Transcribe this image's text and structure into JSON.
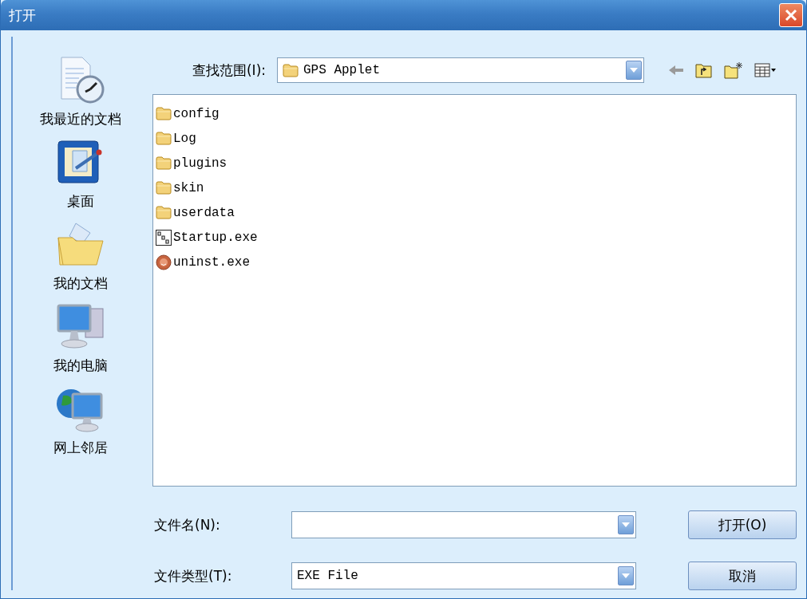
{
  "window": {
    "title": "打开"
  },
  "look_in": {
    "label": "查找范围(I):",
    "value": "GPS Applet"
  },
  "places": [
    {
      "label": "我最近的文档",
      "kind": "recent"
    },
    {
      "label": "桌面",
      "kind": "desktop"
    },
    {
      "label": "我的文档",
      "kind": "documents"
    },
    {
      "label": "我的电脑",
      "kind": "computer"
    },
    {
      "label": "网上邻居",
      "kind": "network"
    }
  ],
  "files": [
    {
      "name": "config",
      "kind": "folder"
    },
    {
      "name": "Log",
      "kind": "folder"
    },
    {
      "name": "plugins",
      "kind": "folder"
    },
    {
      "name": "skin",
      "kind": "folder"
    },
    {
      "name": "userdata",
      "kind": "folder"
    },
    {
      "name": "Startup.exe",
      "kind": "gps-exe"
    },
    {
      "name": "uninst.exe",
      "kind": "uninstaller"
    }
  ],
  "file_name": {
    "label": "文件名(N):"
  },
  "file_type": {
    "label": "文件类型(T):",
    "value": "EXE File"
  },
  "buttons": [
    "打开(O)",
    "取消"
  ]
}
